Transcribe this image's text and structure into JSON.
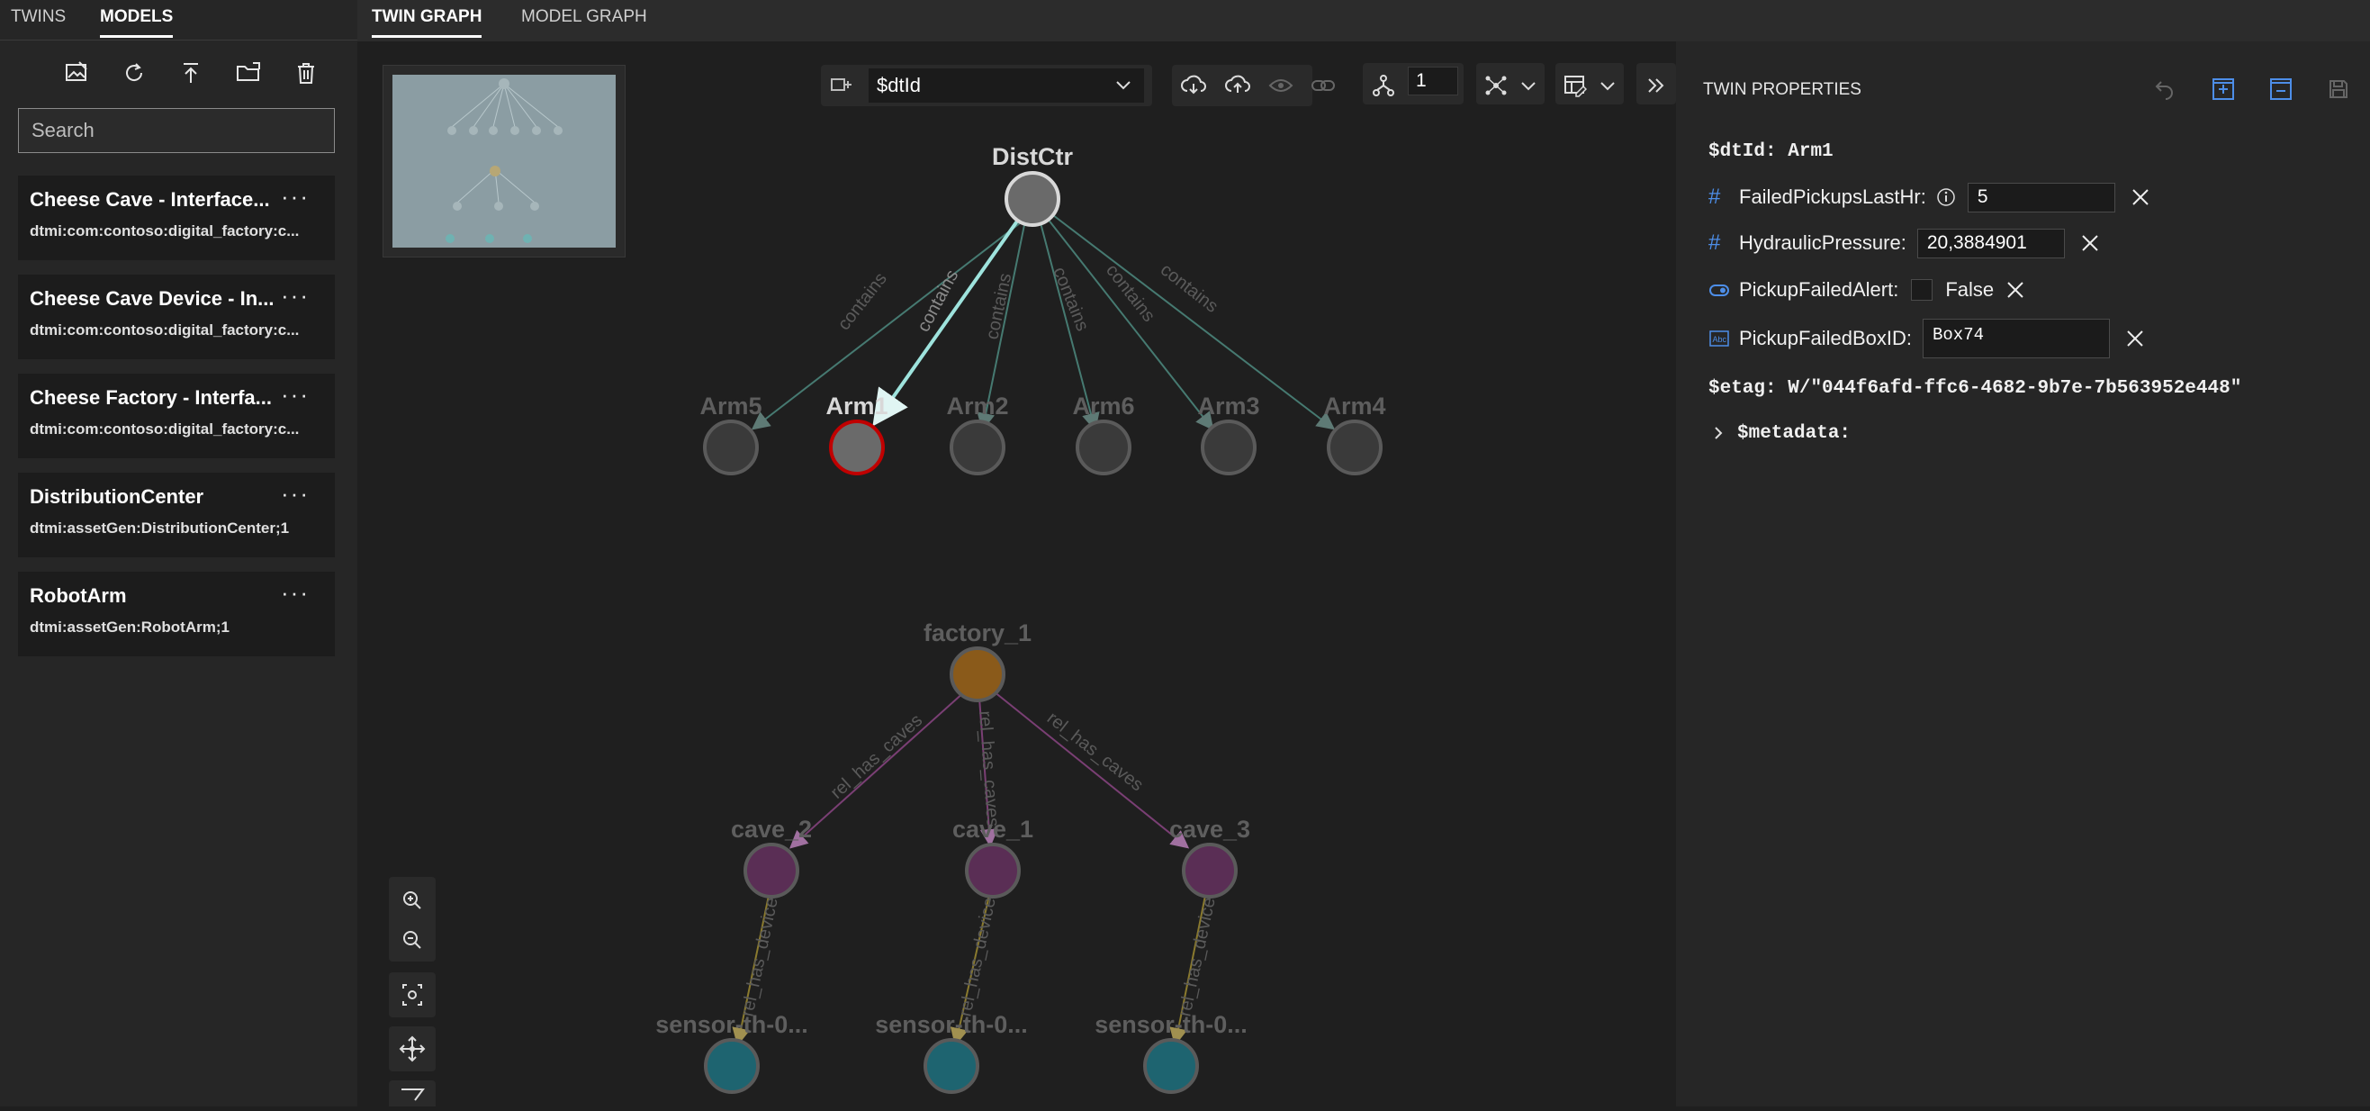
{
  "left_tabs": [
    "TWINS",
    "MODELS"
  ],
  "left_toolbar": [
    "upload-images-icon",
    "refresh-icon",
    "upload-icon",
    "open-folder-icon",
    "delete-icon"
  ],
  "search": {
    "placeholder": "Search"
  },
  "models": [
    {
      "name": "Cheese Cave - Interface...",
      "id": "dtmi:com:contoso:digital_factory:c...",
      "more": "···"
    },
    {
      "name": "Cheese Cave Device - In...",
      "id": "dtmi:com:contoso:digital_factory:c...",
      "more": "···"
    },
    {
      "name": "Cheese Factory - Interfa...",
      "id": "dtmi:com:contoso:digital_factory:c...",
      "more": "···"
    },
    {
      "name": "DistributionCenter",
      "id": "dtmi:assetGen:DistributionCenter;1",
      "more": "···"
    },
    {
      "name": "RobotArm",
      "id": "dtmi:assetGen:RobotArm;1",
      "more": "···"
    }
  ],
  "main_tabs": [
    "TWIN GRAPH",
    "MODEL GRAPH"
  ],
  "graph_toolbar": {
    "label_select": "$dtId",
    "depth": "1"
  },
  "graph": {
    "edge_labels": {
      "contains": "contains",
      "has_caves": "rel_has_caves",
      "has_devices": "rel_has_devices"
    },
    "nodes": {
      "distctr": "DistCtr",
      "arm5": "Arm5",
      "arm1": "Arm1",
      "arm2": "Arm2",
      "arm6": "Arm6",
      "arm3": "Arm3",
      "arm4": "Arm4",
      "factory": "factory_1",
      "cave2": "cave_2",
      "cave1": "cave_1",
      "cave3": "cave_3",
      "sensor_a": "sensor-th-0...",
      "sensor_b": "sensor-th-0...",
      "sensor_c": "sensor-th-0..."
    },
    "colors": {
      "twin_node": "#3a3a3a",
      "selected_ring": "#c00000",
      "contains_edge": "#4d8a80",
      "selected_edge": "#9ee3dd",
      "factory": "#8a5a1a",
      "cave": "#5a2e55",
      "sensor": "#1e6470",
      "caves_edge": "#8e4a86",
      "devices_edge": "#8a7a2e"
    }
  },
  "twin_properties": {
    "title": "TWIN PROPERTIES",
    "dtid_label": "$dtId:",
    "dtid_value": "Arm1",
    "properties": [
      {
        "type_icon": "number-icon",
        "name": "FailedPickupsLastHr:",
        "value": "5"
      },
      {
        "type_icon": "number-icon",
        "name": "HydraulicPressure:",
        "value": "20,3884901"
      },
      {
        "type_icon": "boolean-icon",
        "name": "PickupFailedAlert:",
        "value": "False"
      },
      {
        "type_icon": "string-icon",
        "name": "PickupFailedBoxID:",
        "value": "Box74"
      }
    ],
    "etag_label": "$etag:",
    "etag_value": "W/\"044f6afd-ffc6-4682-9b7e-7b563952e448\"",
    "metadata_label": "$metadata:"
  }
}
